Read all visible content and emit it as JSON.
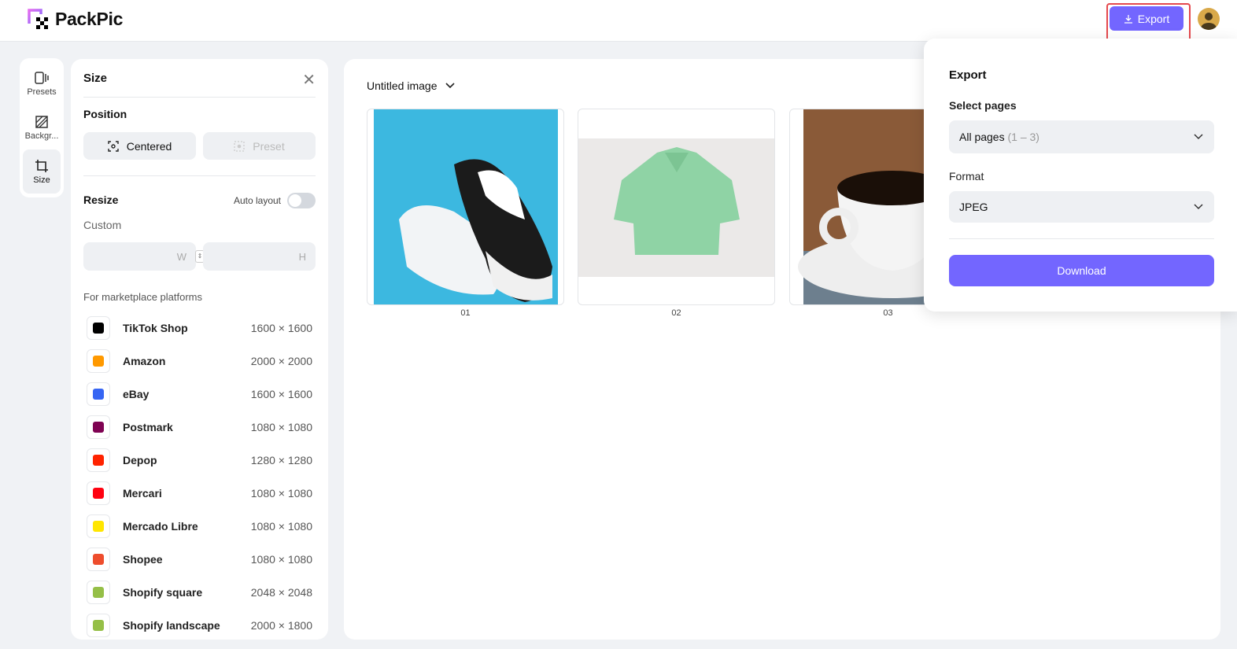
{
  "header": {
    "app_name": "PackPic",
    "export_label": "Export"
  },
  "rail": [
    {
      "label": "Presets",
      "icon": "presets-icon"
    },
    {
      "label": "Backgr...",
      "icon": "background-icon"
    },
    {
      "label": "Size",
      "icon": "crop-icon",
      "active": true
    }
  ],
  "panel": {
    "title": "Size",
    "position_heading": "Position",
    "centered_label": "Centered",
    "preset_label": "Preset",
    "resize_heading": "Resize",
    "auto_layout_label": "Auto layout",
    "auto_layout_on": false,
    "custom_label": "Custom",
    "width_placeholder": "W",
    "height_placeholder": "H",
    "marketplace_heading": "For marketplace platforms",
    "platforms": [
      {
        "name": "TikTok Shop",
        "size": "1600 × 1600",
        "color": "#000000"
      },
      {
        "name": "Amazon",
        "size": "2000 × 2000",
        "color": "#ff9900"
      },
      {
        "name": "eBay",
        "size": "1600 × 1600",
        "color": "#3665f3"
      },
      {
        "name": "Postmark",
        "size": "1080 × 1080",
        "color": "#7f0353"
      },
      {
        "name": "Depop",
        "size": "1280 × 1280",
        "color": "#ff2300"
      },
      {
        "name": "Mercari",
        "size": "1080 × 1080",
        "color": "#ff0211"
      },
      {
        "name": "Mercado Libre",
        "size": "1080 × 1080",
        "color": "#ffe600"
      },
      {
        "name": "Shopee",
        "size": "1080 × 1080",
        "color": "#ee4d2d"
      },
      {
        "name": "Shopify square",
        "size": "2048 × 2048",
        "color": "#95bf47"
      },
      {
        "name": "Shopify landscape",
        "size": "2000 × 1800",
        "color": "#95bf47"
      }
    ]
  },
  "canvas": {
    "doc_title": "Untitled image",
    "pages": [
      {
        "label": "01"
      },
      {
        "label": "02"
      },
      {
        "label": "03"
      }
    ]
  },
  "export_popover": {
    "title": "Export",
    "select_pages_label": "Select pages",
    "pages_value": "All pages",
    "pages_range": "(1 – 3)",
    "format_label": "Format",
    "format_value": "JPEG",
    "download_label": "Download"
  },
  "colors": {
    "accent": "#7366ff",
    "highlight": "#e5484d"
  }
}
